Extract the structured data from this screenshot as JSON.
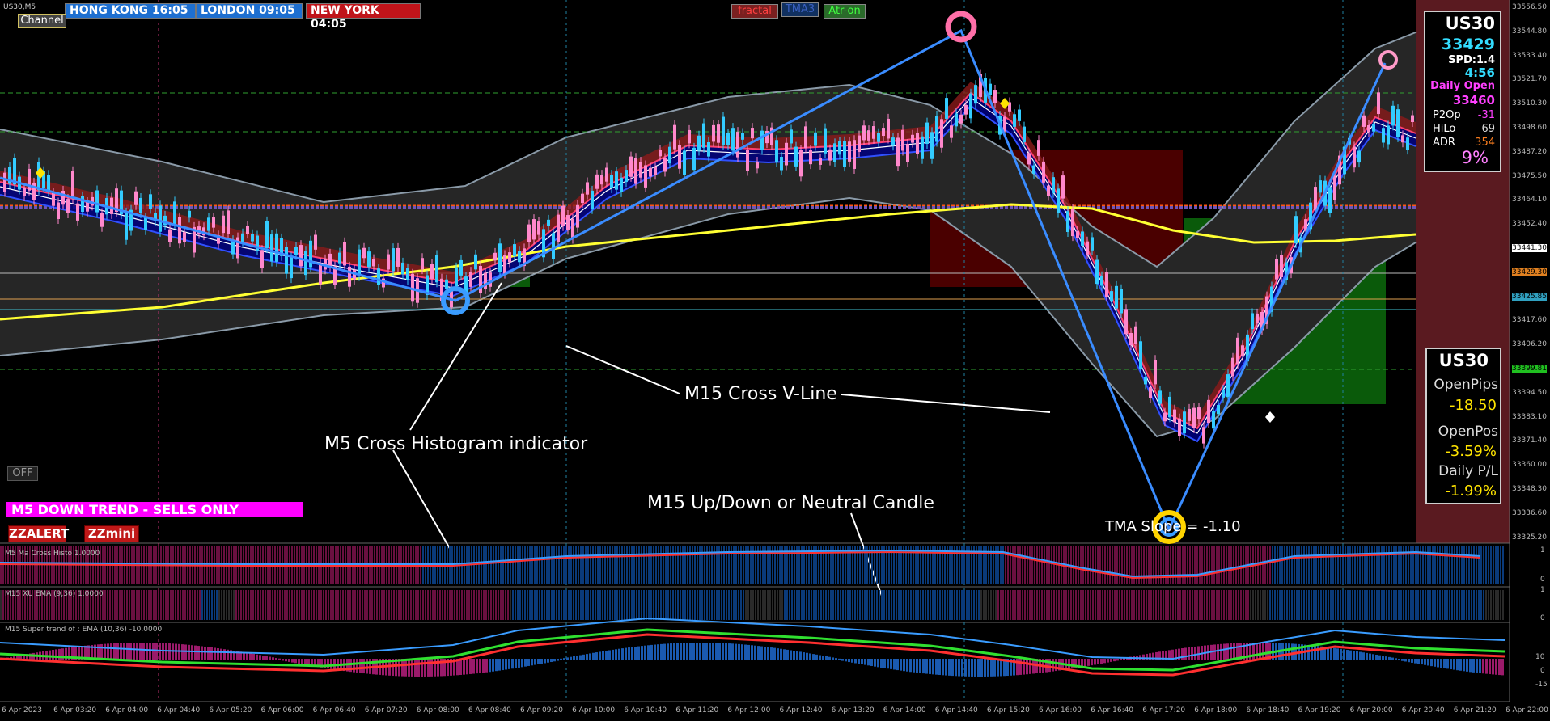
{
  "symbol": "US30,M5",
  "clocks": [
    {
      "label": "HONG KONG  16:05",
      "bg": "#1e6fd0"
    },
    {
      "label": "LONDON  09:05",
      "bg": "#1e6fd0"
    },
    {
      "label": "NEW YORK  04:05",
      "bg": "#c0141a"
    }
  ],
  "top_buttons": [
    {
      "label": "fractal",
      "bg": "#7a2020",
      "fg": "#ff4040"
    },
    {
      "label": "TMA3",
      "bg": "#103060",
      "fg": "#3050a0"
    },
    {
      "label": "Atr-on",
      "bg": "#2a6a2a",
      "fg": "#40ff40"
    }
  ],
  "channel_button": "Channel",
  "off_button": "OFF",
  "trend_banner": "M5  DOWN TREND - SELLS ONLY",
  "alert_buttons": [
    "ZZALERT",
    "ZZmini"
  ],
  "info_panel": {
    "symbol": "US30",
    "price": "33429",
    "spread": "SPD:1.4",
    "timer": "4:56",
    "daily_open_label": "Daily Open",
    "daily_open": "33460",
    "rows": [
      {
        "label": "P2Op",
        "value": "-31",
        "color": "#ff40ff"
      },
      {
        "label": "HiLo",
        "value": "69",
        "color": "#dddddd"
      },
      {
        "label": "ADR",
        "value": "354",
        "color": "#ff8020"
      }
    ],
    "percent": "9%"
  },
  "pnl_panel": {
    "symbol": "US30",
    "rows": [
      {
        "label": "OpenPips",
        "value": "-18.50"
      },
      {
        "label": "OpenPos",
        "value": "-3.59%"
      },
      {
        "label": "Daily P/L",
        "value": "-1.99%"
      }
    ]
  },
  "annotations": {
    "histogram": "M5 Cross Histogram indicator",
    "vline": "M15 Cross V-Line",
    "candle": "M15 Up/Down or Neutral Candle",
    "tma_slope": "TMA Slope = -1.10"
  },
  "subwindows": [
    {
      "label": "M5 Ma Cross Histo 1.0000",
      "scale": [
        "1",
        "0"
      ]
    },
    {
      "label": "M15 XU EMA (9,36) 1.0000",
      "scale": [
        "1",
        "0"
      ]
    },
    {
      "label": "M15  Super trend of : EMA (10,36)  -10.0000",
      "scale": [
        "10",
        "0",
        "-15"
      ]
    }
  ],
  "price_axis": [
    "33556.50",
    "33544.80",
    "33533.40",
    "33521.70",
    "33510.30",
    "33498.60",
    "33487.20",
    "33475.50",
    "33464.10",
    "33452.40",
    "33441.30",
    "33429.30",
    "33425.85",
    "33417.60",
    "33406.20",
    "33399.81",
    "33394.50",
    "33383.10",
    "33371.40",
    "33360.00",
    "33348.30",
    "33336.60",
    "33325.20"
  ],
  "time_axis": [
    "6 Apr 2023",
    "6 Apr 03:20",
    "6 Apr 04:00",
    "6 Apr 04:40",
    "6 Apr 05:20",
    "6 Apr 06:00",
    "6 Apr 06:40",
    "6 Apr 07:20",
    "6 Apr 08:00",
    "6 Apr 08:40",
    "6 Apr 09:20",
    "6 Apr 10:00",
    "6 Apr 10:40",
    "6 Apr 11:20",
    "6 Apr 12:00",
    "6 Apr 12:40",
    "6 Apr 13:20",
    "6 Apr 14:00",
    "6 Apr 14:40",
    "6 Apr 15:20",
    "6 Apr 16:00",
    "6 Apr 16:40",
    "6 Apr 17:20",
    "6 Apr 18:00",
    "6 Apr 18:40",
    "6 Apr 19:20",
    "6 Apr 20:00",
    "6 Apr 20:40",
    "6 Apr 21:20",
    "6 Apr 22:00"
  ],
  "colors": {
    "bull": "#33ccff",
    "bear": "#ff88cc",
    "up_band": "#000080",
    "down_band": "#8b1a1a",
    "ema": "#ffff33",
    "pivot": "#ff5511",
    "pivot2": "#3355ff"
  }
}
